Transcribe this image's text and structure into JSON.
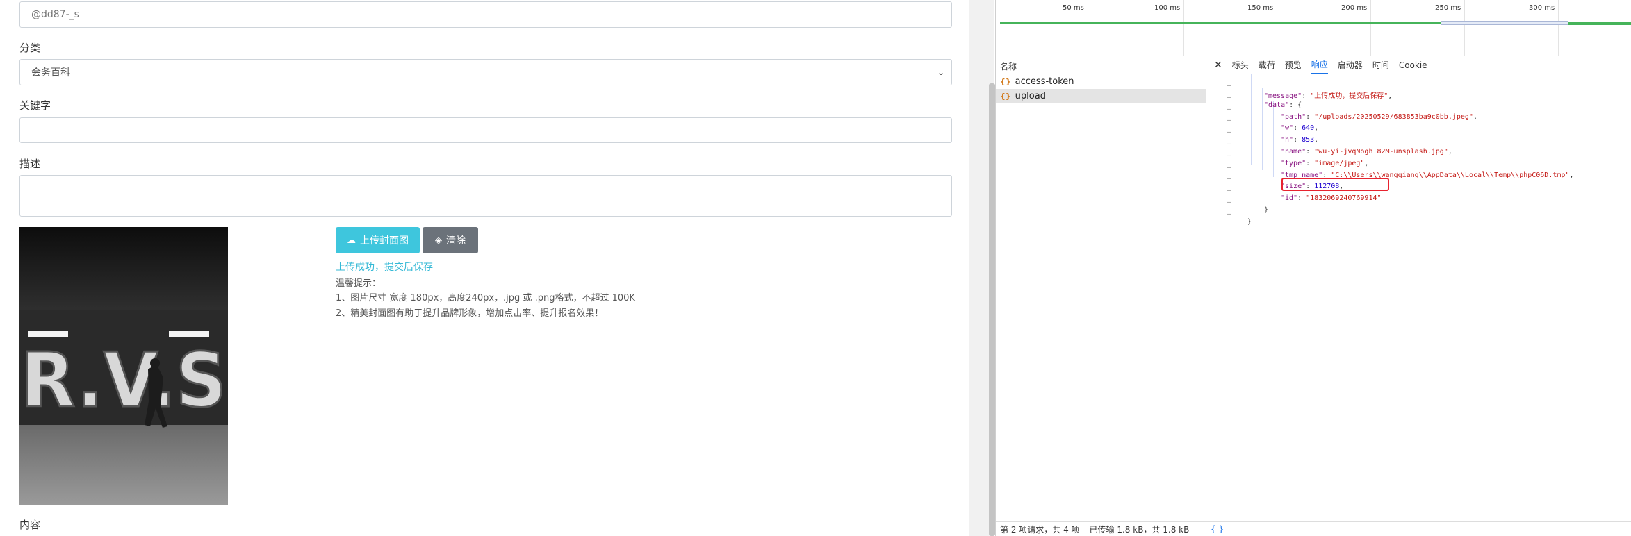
{
  "form": {
    "username_value": "@dd87-_s",
    "category_label": "分类",
    "category_selected": "会务百科",
    "keywords_label": "关键字",
    "keywords_value": "",
    "description_label": "描述",
    "description_value": "",
    "upload_button": "上传封面图",
    "clear_button": "清除",
    "upload_success": "上传成功，提交后保存",
    "tips_title": "温馨提示：",
    "tip1": "1、图片尺寸 宽度 180px，高度240px，.jpg 或 .png格式，不超过 100K",
    "tip2": "2、精美封面图有助于提升品牌形象，增加点击率、提升报名效果！",
    "content_label": "内容",
    "cover_image_text": "R.V.S"
  },
  "devtools": {
    "timeline_ticks": [
      "50 ms",
      "100 ms",
      "150 ms",
      "200 ms",
      "250 ms",
      "300 ms"
    ],
    "requests_header": "名称",
    "requests": [
      {
        "name": "access-token",
        "selected": false
      },
      {
        "name": "upload",
        "selected": true
      }
    ],
    "tabs": [
      "标头",
      "载荷",
      "预览",
      "响应",
      "启动器",
      "时间",
      "Cookie"
    ],
    "active_tab": "响应",
    "response": {
      "message_key": "\"message\"",
      "message_value": "\"上传成功，提交后保存\"",
      "data_key": "\"data\"",
      "path_key": "\"path\"",
      "path_value": "\"/uploads/20250529/683853ba9c0bb.jpeg\"",
      "w_key": "\"w\"",
      "w_value": "640",
      "h_key": "\"h\"",
      "h_value": "853",
      "name_key": "\"name\"",
      "name_value": "\"wu-yi-jvqNoghT82M-unsplash.jpg\"",
      "type_key": "\"type\"",
      "type_value": "\"image/jpeg\"",
      "tmp_key": "\"tmp_name\"",
      "tmp_value": "\"C:\\\\Users\\\\wangqiang\\\\AppData\\\\Local\\\\Temp\\\\phpC06D.tmp\"",
      "size_key": "\"size\"",
      "size_value": "112708",
      "id_key": "\"id\"",
      "id_value": "\"1832069240769914\""
    },
    "status_requests": "第 2 项请求，共 4 项",
    "status_transferred": "已传输 1.8 kB，共 1.8 kB",
    "status_format": "{ }"
  }
}
